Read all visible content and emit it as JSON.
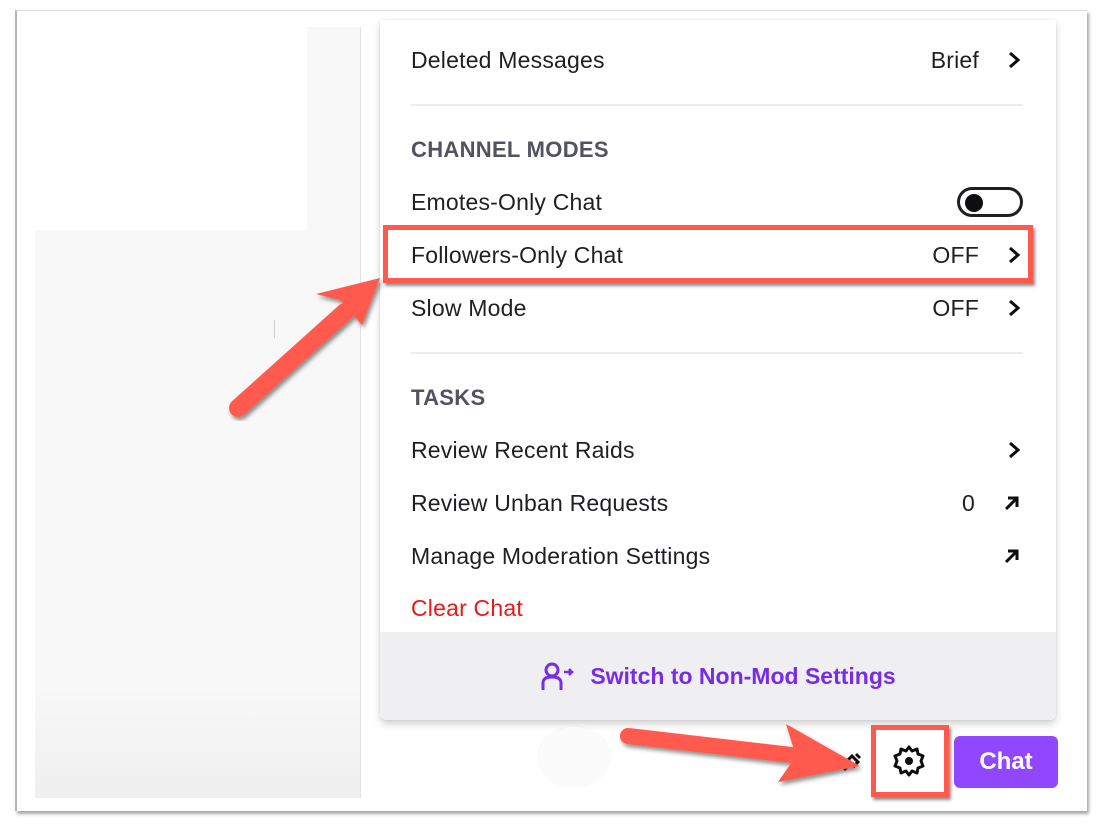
{
  "menu": {
    "deleted_messages": {
      "label": "Deleted Messages",
      "value": "Brief"
    },
    "channel_modes": {
      "header": "CHANNEL MODES",
      "emotes_only": {
        "label": "Emotes-Only Chat",
        "enabled": false
      },
      "followers_only": {
        "label": "Followers-Only Chat",
        "value": "OFF"
      },
      "slow_mode": {
        "label": "Slow Mode",
        "value": "OFF"
      }
    },
    "tasks": {
      "header": "TASKS",
      "review_raids": {
        "label": "Review Recent Raids"
      },
      "review_unban": {
        "label": "Review Unban Requests",
        "count": "0"
      },
      "manage_moderation": {
        "label": "Manage Moderation Settings"
      },
      "clear_chat": {
        "label": "Clear Chat"
      }
    },
    "footer": {
      "label": "Switch to Non-Mod Settings",
      "icon": "user-switch-icon"
    }
  },
  "bottom_bar": {
    "chat_button": "Chat",
    "settings_icon": "gear-icon"
  },
  "colors": {
    "accent": "#9147ff",
    "footer_text": "#772ce8",
    "danger": "#e91916",
    "annotation": "#ff5a4e"
  }
}
